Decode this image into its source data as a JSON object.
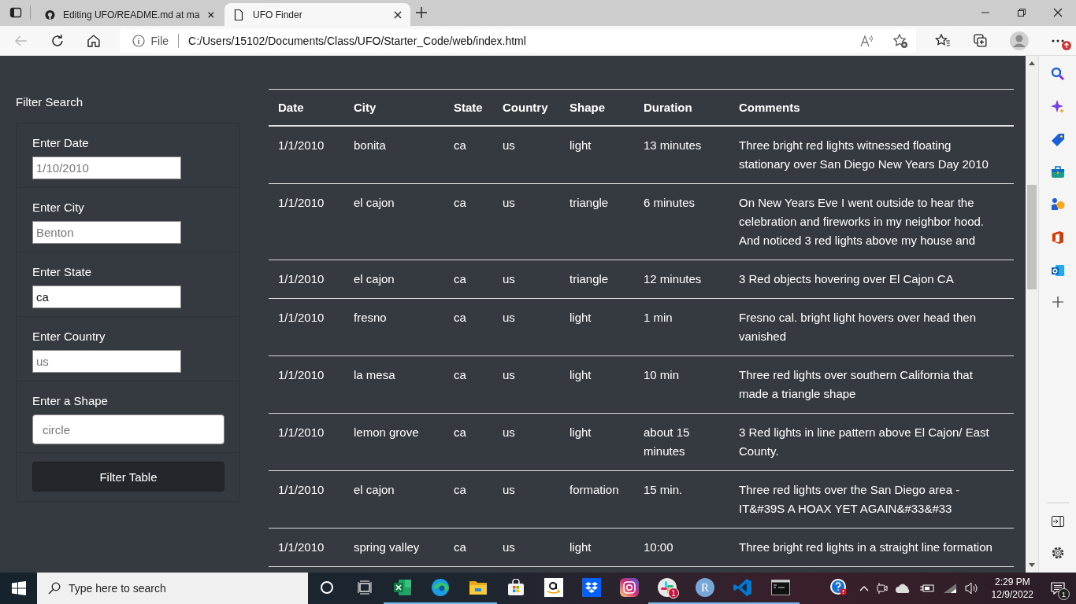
{
  "browser": {
    "tabs": [
      {
        "title": "Editing UFO/README.md at ma",
        "kind": "github",
        "selected": false
      },
      {
        "title": "UFO Finder",
        "kind": "page",
        "selected": true
      }
    ],
    "address": {
      "scheme": "File",
      "url": "C:/Users/15102/Documents/Class/UFO/Starter_Code/web/index.html"
    },
    "menu_badge": true
  },
  "filter": {
    "title": "Filter Search",
    "fields": [
      {
        "label": "Enter Date",
        "placeholder": "1/10/2010",
        "kind": "plain"
      },
      {
        "label": "Enter City",
        "placeholder": "Benton",
        "kind": "plain"
      },
      {
        "label": "Enter State",
        "value": "ca",
        "kind": "plain"
      },
      {
        "label": "Enter Country",
        "placeholder": "us",
        "kind": "plain"
      },
      {
        "label": "Enter a Shape",
        "placeholder": "circle",
        "kind": "styled"
      }
    ],
    "button": "Filter Table"
  },
  "table": {
    "columns": [
      "Date",
      "City",
      "State",
      "Country",
      "Shape",
      "Duration",
      "Comments"
    ],
    "rows": [
      [
        "1/1/2010",
        "bonita",
        "ca",
        "us",
        "light",
        "13 minutes",
        "Three bright red lights witnessed floating stationary over San Diego New Years Day 2010"
      ],
      [
        "1/1/2010",
        "el cajon",
        "ca",
        "us",
        "triangle",
        "6 minutes",
        "On New Years Eve I went outside to hear the celebration and fireworks in my neighbor hood. And noticed 3 red lights above my house and"
      ],
      [
        "1/1/2010",
        "el cajon",
        "ca",
        "us",
        "triangle",
        "12 minutes",
        "3 Red objects hovering over El Cajon CA"
      ],
      [
        "1/1/2010",
        "fresno",
        "ca",
        "us",
        "light",
        "1 min",
        "Fresno cal. bright light hovers over head then vanished"
      ],
      [
        "1/1/2010",
        "la mesa",
        "ca",
        "us",
        "light",
        "10 min",
        "Three red lights over southern California that made a triangle shape"
      ],
      [
        "1/1/2010",
        "lemon grove",
        "ca",
        "us",
        "light",
        "about 15 minutes",
        "3 Red lights in line pattern above El Cajon/ East County."
      ],
      [
        "1/1/2010",
        "el cajon",
        "ca",
        "us",
        "formation",
        "15 min.",
        "Three red lights over the San Diego area - IT&#39S A HOAX YET AGAIN&#33&#33"
      ],
      [
        "1/1/2010",
        "spring valley",
        "ca",
        "us",
        "light",
        "10:00",
        "Three bright red lights in a straight line formation"
      ]
    ]
  },
  "taskbar": {
    "search_placeholder": "Type here to search",
    "apps": [
      {
        "kind": "cortana",
        "running": false
      },
      {
        "kind": "taskview",
        "running": false
      },
      {
        "kind": "excel",
        "running": true
      },
      {
        "kind": "edge",
        "running": true
      },
      {
        "kind": "folder",
        "running": true
      },
      {
        "kind": "store",
        "running": false
      },
      {
        "kind": "amazon",
        "running": false
      },
      {
        "kind": "dropbox",
        "running": false
      },
      {
        "kind": "instagram",
        "running": false
      },
      {
        "kind": "slack",
        "running": true,
        "badge": "1"
      },
      {
        "kind": "r",
        "running": true,
        "label": "R"
      },
      {
        "kind": "vscode",
        "running": true
      },
      {
        "kind": "terminal",
        "running": true
      }
    ],
    "time": "2:29 PM",
    "date": "12/9/2022",
    "notification_badge": "1"
  }
}
